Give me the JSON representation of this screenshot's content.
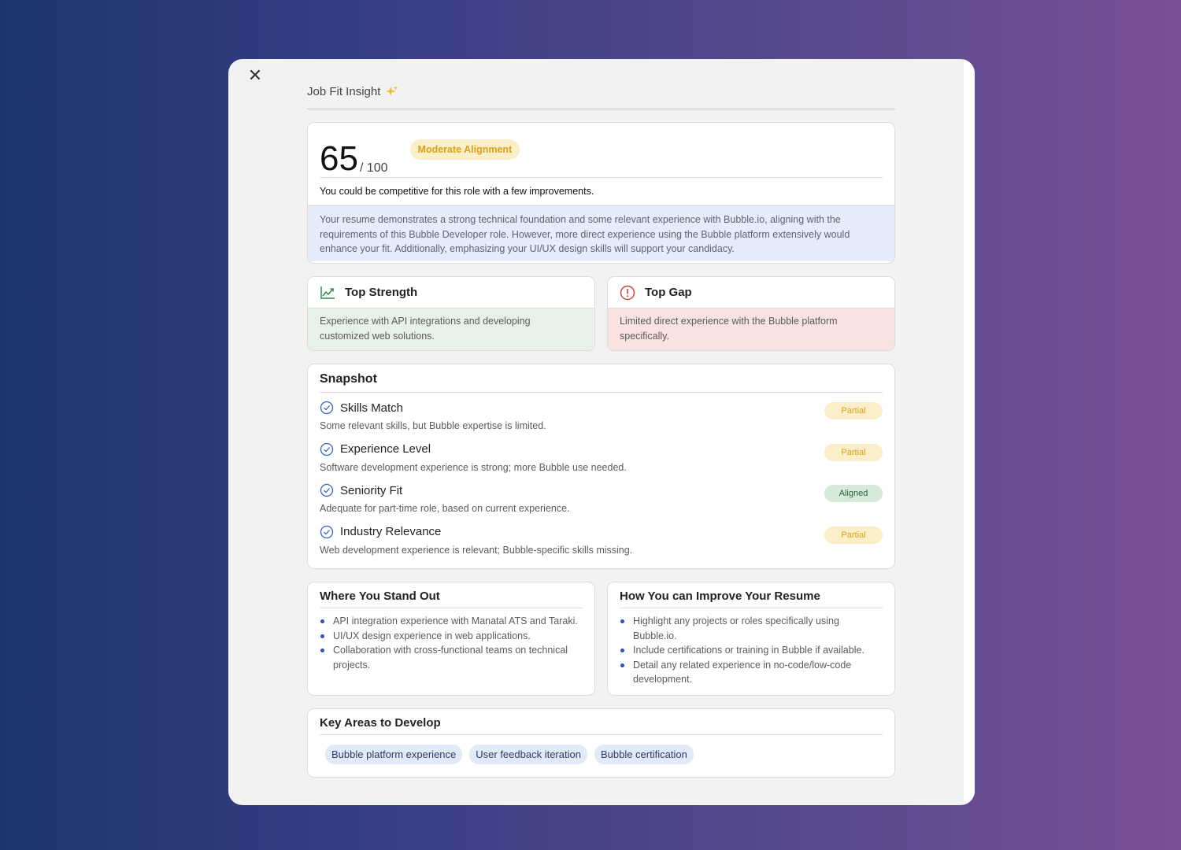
{
  "modal": {
    "close_icon": "close-icon",
    "header": {
      "title": "Job Fit Insight",
      "icon": "sparkle-icon"
    }
  },
  "score": {
    "value": "65",
    "max": "/ 100",
    "badge": "Moderate Alignment",
    "subtitle": "You could be competitive for this role with a few improvements.",
    "description": "Your resume demonstrates a strong technical foundation and some relevant experience with Bubble.io, aligning with the requirements of this Bubble Developer role. However, more direct experience using the Bubble platform extensively would enhance your fit. Additionally, emphasizing your UI/UX design skills will support your candidacy."
  },
  "top_strength": {
    "title": "Top Strength",
    "icon": "trend-up-icon",
    "text": "Experience with API integrations and developing customized web solutions."
  },
  "top_gap": {
    "title": "Top Gap",
    "icon": "alert-circle-icon",
    "text": "Limited direct experience with the Bubble platform specifically."
  },
  "snapshot": {
    "title": "Snapshot",
    "items": [
      {
        "label": "Skills Match",
        "desc": "Some relevant skills, but Bubble expertise is limited.",
        "status": "Partial"
      },
      {
        "label": "Experience Level",
        "desc": "Software development experience is strong; more Bubble use needed.",
        "status": "Partial"
      },
      {
        "label": "Seniority Fit",
        "desc": "Adequate for part-time role, based on current experience.",
        "status": "Aligned"
      },
      {
        "label": "Industry Relevance",
        "desc": "Web development experience is relevant; Bubble-specific skills missing.",
        "status": "Partial"
      }
    ]
  },
  "stand_out": {
    "title": "Where You Stand Out",
    "items": [
      "API integration experience with Manatal ATS and Taraki.",
      "UI/UX design experience in web applications.",
      "Collaboration with cross-functional teams on technical projects."
    ]
  },
  "improve": {
    "title": "How You can Improve Your Resume",
    "items": [
      "Highlight any projects or roles specifically using Bubble.io.",
      "Include certifications or training in Bubble if available.",
      "Detail any related experience in no-code/low-code development."
    ]
  },
  "key_areas": {
    "title": "Key Areas to Develop",
    "chips": [
      "Bubble platform experience",
      "User feedback iteration",
      "Bubble certification"
    ]
  },
  "colors": {
    "partial_bg": "#fbefc9",
    "partial_text": "#d9a21b",
    "aligned_bg": "#d5ead9",
    "aligned_text": "#33613f",
    "strength_bg": "#e7f1ea",
    "gap_bg": "#f9e3e1",
    "info_bg": "#e6ecf9"
  }
}
